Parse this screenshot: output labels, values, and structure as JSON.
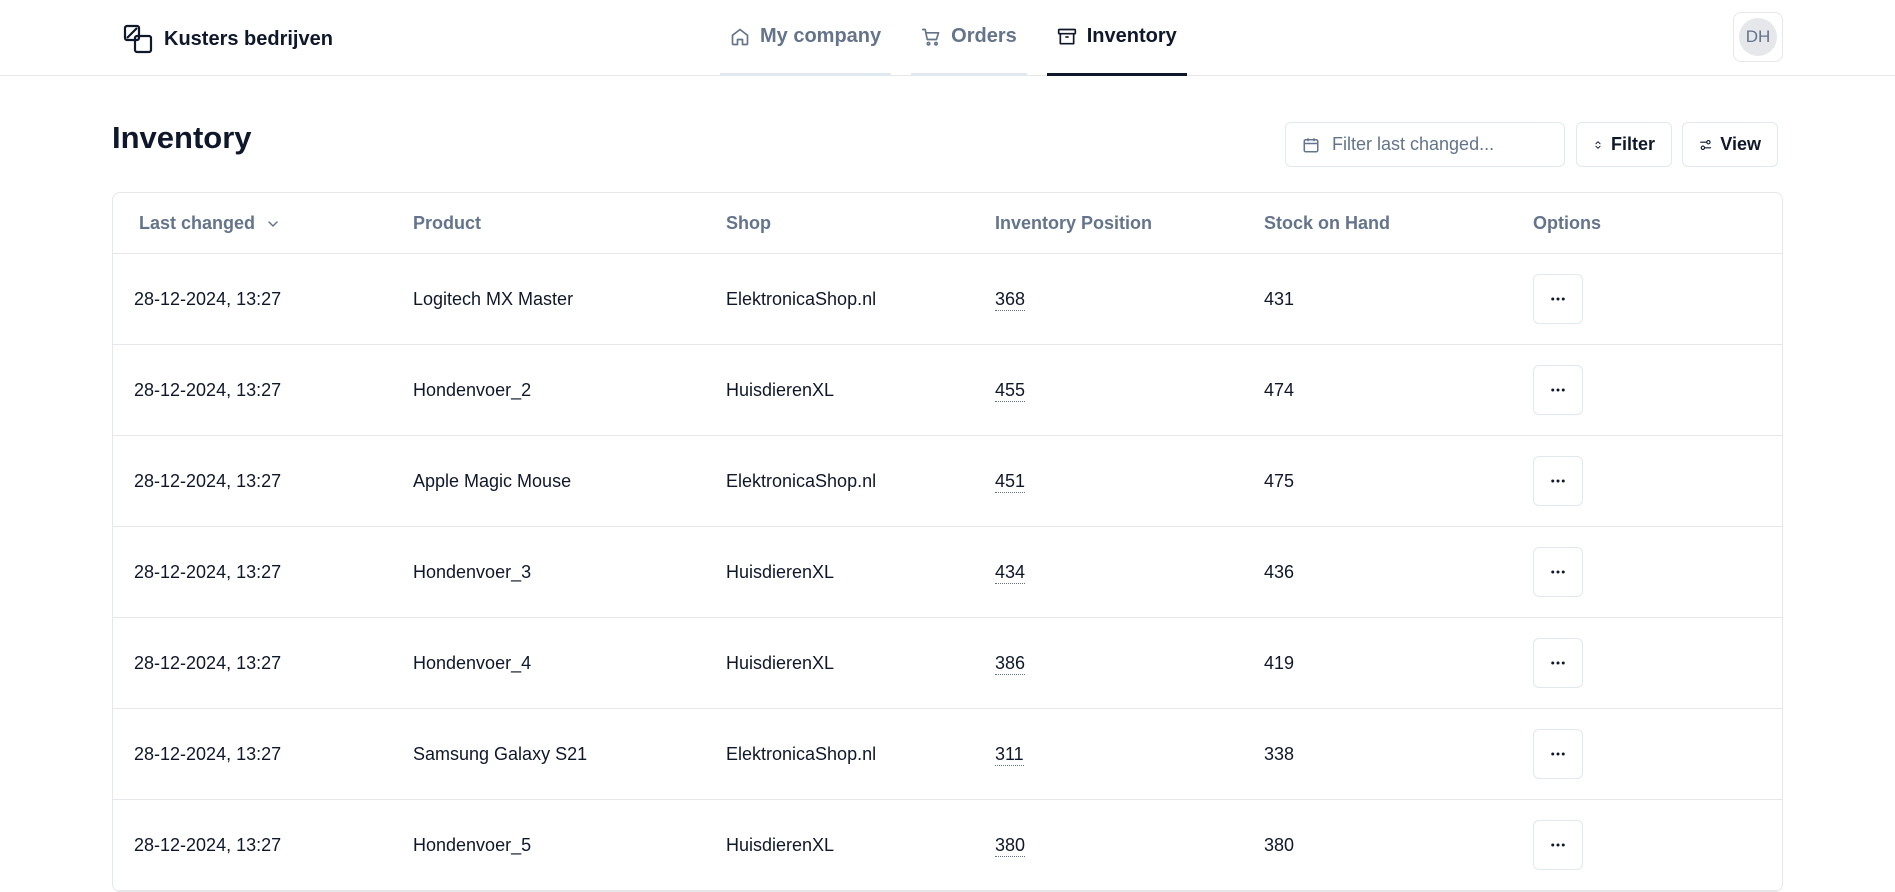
{
  "brand": {
    "name": "Kusters bedrijven",
    "icon": "logo-icon"
  },
  "nav": {
    "tabs": [
      {
        "label": "My company",
        "icon": "home-icon",
        "active": false
      },
      {
        "label": "Orders",
        "icon": "cart-icon",
        "active": false
      },
      {
        "label": "Inventory",
        "icon": "archive-icon",
        "active": true
      }
    ]
  },
  "user": {
    "initials": "DH"
  },
  "page": {
    "title": "Inventory"
  },
  "toolbar": {
    "date_placeholder": "Filter last changed...",
    "filter_label": "Filter",
    "view_label": "View"
  },
  "table": {
    "columns": [
      "Last changed",
      "Product",
      "Shop",
      "Inventory Position",
      "Stock on Hand",
      "Options"
    ],
    "sort_column": "Last changed",
    "rows": [
      {
        "last_changed": "28-12-2024, 13:27",
        "product": "Logitech MX Master",
        "shop": "ElektronicaShop.nl",
        "position": "368",
        "stock": "431"
      },
      {
        "last_changed": "28-12-2024, 13:27",
        "product": "Hondenvoer_2",
        "shop": "HuisdierenXL",
        "position": "455",
        "stock": "474"
      },
      {
        "last_changed": "28-12-2024, 13:27",
        "product": "Apple Magic Mouse",
        "shop": "ElektronicaShop.nl",
        "position": "451",
        "stock": "475"
      },
      {
        "last_changed": "28-12-2024, 13:27",
        "product": "Hondenvoer_3",
        "shop": "HuisdierenXL",
        "position": "434",
        "stock": "436"
      },
      {
        "last_changed": "28-12-2024, 13:27",
        "product": "Hondenvoer_4",
        "shop": "HuisdierenXL",
        "position": "386",
        "stock": "419"
      },
      {
        "last_changed": "28-12-2024, 13:27",
        "product": "Samsung Galaxy S21",
        "shop": "ElektronicaShop.nl",
        "position": "311",
        "stock": "338"
      },
      {
        "last_changed": "28-12-2024, 13:27",
        "product": "Hondenvoer_5",
        "shop": "HuisdierenXL",
        "position": "380",
        "stock": "380"
      }
    ]
  },
  "colors": {
    "text": "#0f172a",
    "muted": "#64748b",
    "border": "#e5e7eb"
  }
}
